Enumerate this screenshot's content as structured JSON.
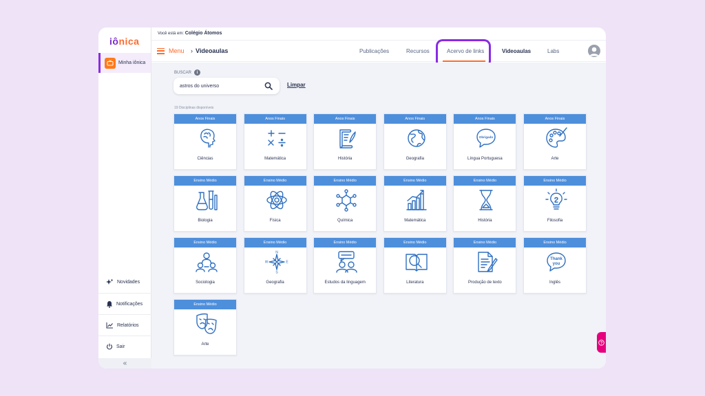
{
  "brand": {
    "logo_part1": "iô",
    "logo_part2": "nica"
  },
  "breadcrumb": {
    "prefix": "Você está em:",
    "school": "Colégio Átomos"
  },
  "sidebar": {
    "home_label": "Minha iônica",
    "links": [
      "Novidades",
      "Notificações",
      "Relatórios",
      "Sair"
    ],
    "collapse": "«"
  },
  "topbar": {
    "menu_label": "Menu",
    "page_title": "Videoaulas",
    "tabs": [
      "Publicações",
      "Recursos",
      "Acervo de links",
      "Videoaulas",
      "Labs"
    ],
    "active_tab": "Videoaulas"
  },
  "search": {
    "label": "BUSCAR",
    "value": "astros do universo",
    "clear_label": "Limpar"
  },
  "results_count": "19 Disciplinas disponíveis",
  "colors": {
    "accent_orange": "#ff6a2c",
    "accent_purple": "#8a2be2",
    "card_header": "#4e8fdc",
    "help_button": "#e6007e"
  },
  "cards": [
    {
      "level": "Anos Finais",
      "name": "Ciências",
      "icon": "head-brain-icon"
    },
    {
      "level": "Anos Finais",
      "name": "Matemática",
      "icon": "math-operators-icon"
    },
    {
      "level": "Anos Finais",
      "name": "História",
      "icon": "scroll-quill-icon"
    },
    {
      "level": "Anos Finais",
      "name": "Geografia",
      "icon": "globe-icon"
    },
    {
      "level": "Anos Finais",
      "name": "Língua Portuguesa",
      "icon": "speech-bubble-icon",
      "icon_text": "Obrigado"
    },
    {
      "level": "Anos Finais",
      "name": "Arte",
      "icon": "palette-icon"
    },
    {
      "level": "Ensino Médio",
      "name": "Biologia",
      "icon": "lab-flasks-icon"
    },
    {
      "level": "Ensino Médio",
      "name": "Física",
      "icon": "atom-icon"
    },
    {
      "level": "Ensino Médio",
      "name": "Química",
      "icon": "molecule-icon"
    },
    {
      "level": "Ensino Médio",
      "name": "Matemática",
      "icon": "bar-chart-icon"
    },
    {
      "level": "Ensino Médio",
      "name": "História",
      "icon": "hourglass-icon"
    },
    {
      "level": "Ensino Médio",
      "name": "Filosofia",
      "icon": "lightbulb-icon"
    },
    {
      "level": "Ensino Médio",
      "name": "Sociologia",
      "icon": "people-network-icon"
    },
    {
      "level": "Ensino Médio",
      "name": "Geografia",
      "icon": "compass-rose-icon",
      "icon_text": "N E S W"
    },
    {
      "level": "Ensino Médio",
      "name": "Estudos da linguagem",
      "icon": "conversation-icon"
    },
    {
      "level": "Ensino Médio",
      "name": "Literatura",
      "icon": "book-magnifier-icon"
    },
    {
      "level": "Ensino Médio",
      "name": "Produção de texto",
      "icon": "document-pen-icon"
    },
    {
      "level": "Ensino Médio",
      "name": "Inglês",
      "icon": "thank-you-bubble-icon",
      "icon_text": "Thank you"
    },
    {
      "level": "Ensino Médio",
      "name": "Arte",
      "icon": "theater-masks-icon"
    }
  ]
}
